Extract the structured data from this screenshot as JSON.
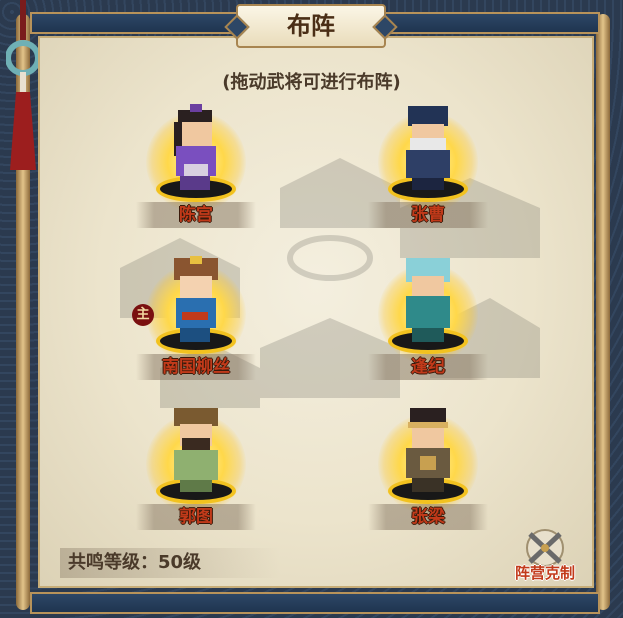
{
  "title": "布阵",
  "hint": "(拖动武将可进行布阵)",
  "heroes": [
    {
      "name": "陈宫",
      "badge": ""
    },
    {
      "name": "张曹",
      "badge": ""
    },
    {
      "name": "南国柳丝",
      "badge": "主"
    },
    {
      "name": "逢纪",
      "badge": ""
    },
    {
      "name": "郭图",
      "badge": ""
    },
    {
      "name": "张梁",
      "badge": ""
    }
  ],
  "resonance_text": "共鸣等级：50级",
  "formation_button_label": "阵营克制",
  "colors": {
    "frame": "#2b3a4f",
    "panel": "#f4efdf",
    "name_red": "#c23a1a",
    "ring_gold": "#f2c21f"
  }
}
